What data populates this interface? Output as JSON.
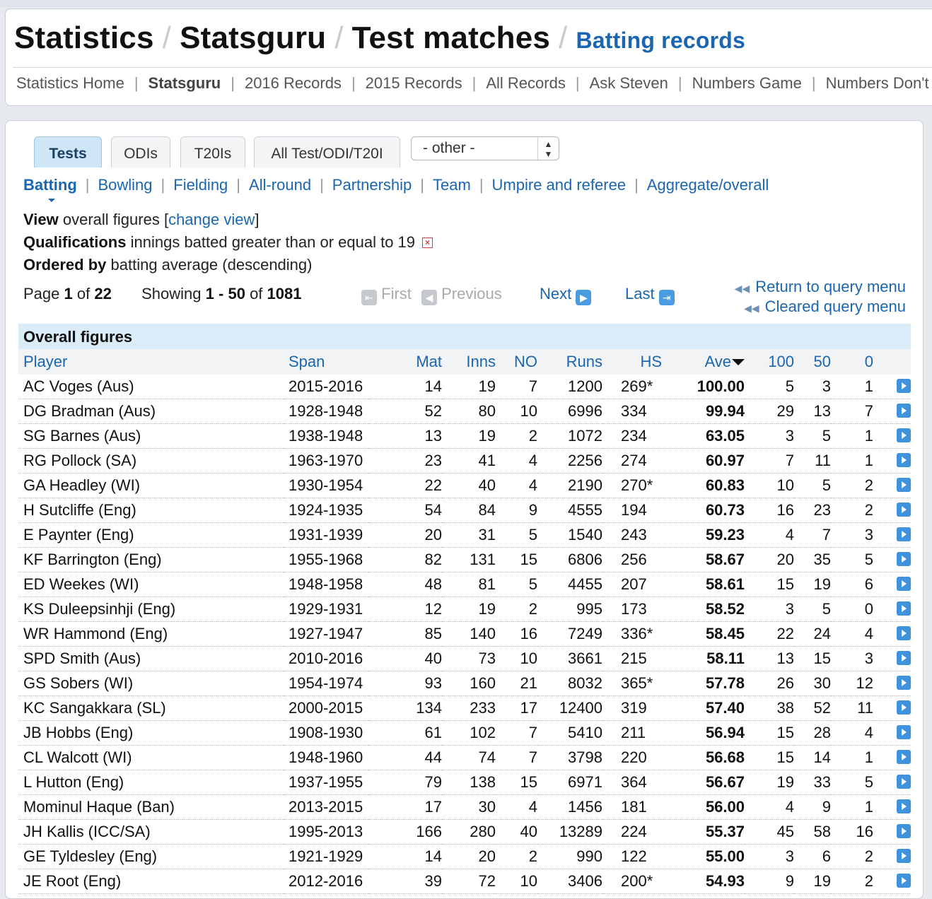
{
  "header": {
    "crumbs": [
      "Statistics",
      "Statsguru",
      "Test matches"
    ],
    "current": "Batting records"
  },
  "subnav": [
    "Statistics Home",
    "Statsguru",
    "2016 Records",
    "2015 Records",
    "All Records",
    "Ask Steven",
    "Numbers Game",
    "Numbers Don't L"
  ],
  "tabs": [
    "Tests",
    "ODIs",
    "T20Is",
    "All Test/ODI/T20I"
  ],
  "other_select": "- other -",
  "catnav": [
    "Batting",
    "Bowling",
    "Fielding",
    "All-round",
    "Partnership",
    "Team",
    "Umpire and referee",
    "Aggregate/overall"
  ],
  "info": {
    "view_label": "View",
    "view_text": "overall figures [",
    "change_view": "change view",
    "view_close": "]",
    "qual_label": "Qualifications",
    "qual_text": "innings batted greater than or equal to 19",
    "order_label": "Ordered by",
    "order_text": "batting average (descending)"
  },
  "pager": {
    "page_word": "Page",
    "page": "1",
    "of_word": "of",
    "pages": "22",
    "showing_word": "Showing",
    "from": "1",
    "dash": "-",
    "to": "50",
    "of_word2": "of",
    "total": "1081",
    "first": "First",
    "previous": "Previous",
    "next": "Next",
    "last": "Last",
    "return_query": "Return to query menu",
    "cleared_query": "Cleared query menu"
  },
  "table": {
    "caption": "Overall figures",
    "columns": [
      "Player",
      "Span",
      "Mat",
      "Inns",
      "NO",
      "Runs",
      "HS",
      "Ave",
      "100",
      "50",
      "0"
    ],
    "rows": [
      [
        "AC Voges (Aus)",
        "2015-2016",
        "14",
        "19",
        "7",
        "1200",
        "269*",
        "100.00",
        "5",
        "3",
        "1"
      ],
      [
        "DG Bradman (Aus)",
        "1928-1948",
        "52",
        "80",
        "10",
        "6996",
        "334",
        "99.94",
        "29",
        "13",
        "7"
      ],
      [
        "SG Barnes (Aus)",
        "1938-1948",
        "13",
        "19",
        "2",
        "1072",
        "234",
        "63.05",
        "3",
        "5",
        "1"
      ],
      [
        "RG Pollock (SA)",
        "1963-1970",
        "23",
        "41",
        "4",
        "2256",
        "274",
        "60.97",
        "7",
        "11",
        "1"
      ],
      [
        "GA Headley (WI)",
        "1930-1954",
        "22",
        "40",
        "4",
        "2190",
        "270*",
        "60.83",
        "10",
        "5",
        "2"
      ],
      [
        "H Sutcliffe (Eng)",
        "1924-1935",
        "54",
        "84",
        "9",
        "4555",
        "194",
        "60.73",
        "16",
        "23",
        "2"
      ],
      [
        "E Paynter (Eng)",
        "1931-1939",
        "20",
        "31",
        "5",
        "1540",
        "243",
        "59.23",
        "4",
        "7",
        "3"
      ],
      [
        "KF Barrington (Eng)",
        "1955-1968",
        "82",
        "131",
        "15",
        "6806",
        "256",
        "58.67",
        "20",
        "35",
        "5"
      ],
      [
        "ED Weekes (WI)",
        "1948-1958",
        "48",
        "81",
        "5",
        "4455",
        "207",
        "58.61",
        "15",
        "19",
        "6"
      ],
      [
        "KS Duleepsinhji (Eng)",
        "1929-1931",
        "12",
        "19",
        "2",
        "995",
        "173",
        "58.52",
        "3",
        "5",
        "0"
      ],
      [
        "WR Hammond (Eng)",
        "1927-1947",
        "85",
        "140",
        "16",
        "7249",
        "336*",
        "58.45",
        "22",
        "24",
        "4"
      ],
      [
        "SPD Smith (Aus)",
        "2010-2016",
        "40",
        "73",
        "10",
        "3661",
        "215",
        "58.11",
        "13",
        "15",
        "3"
      ],
      [
        "GS Sobers (WI)",
        "1954-1974",
        "93",
        "160",
        "21",
        "8032",
        "365*",
        "57.78",
        "26",
        "30",
        "12"
      ],
      [
        "KC Sangakkara (SL)",
        "2000-2015",
        "134",
        "233",
        "17",
        "12400",
        "319",
        "57.40",
        "38",
        "52",
        "11"
      ],
      [
        "JB Hobbs (Eng)",
        "1908-1930",
        "61",
        "102",
        "7",
        "5410",
        "211",
        "56.94",
        "15",
        "28",
        "4"
      ],
      [
        "CL Walcott (WI)",
        "1948-1960",
        "44",
        "74",
        "7",
        "3798",
        "220",
        "56.68",
        "15",
        "14",
        "1"
      ],
      [
        "L Hutton (Eng)",
        "1937-1955",
        "79",
        "138",
        "15",
        "6971",
        "364",
        "56.67",
        "19",
        "33",
        "5"
      ],
      [
        "Mominul Haque (Ban)",
        "2013-2015",
        "17",
        "30",
        "4",
        "1456",
        "181",
        "56.00",
        "4",
        "9",
        "1"
      ],
      [
        "JH Kallis (ICC/SA)",
        "1995-2013",
        "166",
        "280",
        "40",
        "13289",
        "224",
        "55.37",
        "45",
        "58",
        "16"
      ],
      [
        "GE Tyldesley (Eng)",
        "1921-1929",
        "14",
        "20",
        "2",
        "990",
        "122",
        "55.00",
        "3",
        "6",
        "2"
      ],
      [
        "JE Root (Eng)",
        "2012-2016",
        "39",
        "72",
        "10",
        "3406",
        "200*",
        "54.93",
        "9",
        "19",
        "2"
      ]
    ]
  }
}
